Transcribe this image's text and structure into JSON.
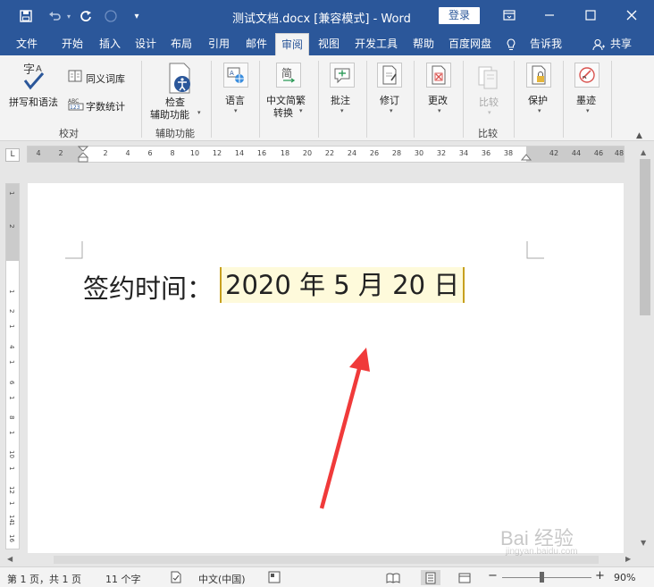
{
  "window": {
    "title": "测试文档.docx [兼容模式] - Word",
    "login_label": "登录",
    "quick_access": [
      "save-icon",
      "undo-icon",
      "redo-icon",
      "circle-icon",
      "customize-icon"
    ],
    "controls": [
      "ribbon-display-icon",
      "minimize-icon",
      "maximize-icon",
      "close-icon"
    ]
  },
  "tabs": [
    "文件",
    "开始",
    "插入",
    "设计",
    "布局",
    "引用",
    "邮件",
    "审阅",
    "视图",
    "开发工具",
    "帮助",
    "百度网盘"
  ],
  "active_tab": "审阅",
  "tell_me": "告诉我",
  "share": "共享",
  "ribbon": {
    "proofing": {
      "spelling": "拼写和语法",
      "thesaurus": "同义词库",
      "word_count": "字数统计",
      "group": "校对"
    },
    "accessibility": {
      "check_line1": "检查",
      "check_line2": "辅助功能",
      "group": "辅助功能"
    },
    "language": "语言",
    "chinese_conv_line1": "中文简繁",
    "chinese_conv_line2": "转换",
    "comments": "批注",
    "tracking": "修订",
    "changes": "更改",
    "compare": {
      "button": "比较",
      "group": "比较"
    },
    "protect": "保护",
    "ink": "墨迹"
  },
  "ruler": {
    "tab_selector": "L",
    "h_numbers": [
      "4",
      "2",
      "2",
      "4",
      "6",
      "8",
      "10",
      "12",
      "14",
      "16",
      "18",
      "20",
      "22",
      "24",
      "26",
      "28",
      "30",
      "32",
      "34",
      "36",
      "38",
      "42",
      "44",
      "46",
      "48"
    ],
    "v_numbers": [
      "1",
      "2",
      "1",
      "2",
      "1",
      "4",
      "1",
      "6",
      "1",
      "8",
      "1",
      "10",
      "1",
      "12",
      "1",
      "14",
      "1",
      "16"
    ]
  },
  "document": {
    "label": "签约时间：",
    "date_field": "2020 年 5 月 20 日"
  },
  "status": {
    "page": "第 1 页，共 1 页",
    "words": "11 个字",
    "language": "中文(中国)",
    "zoom": "90%",
    "zoom_fraction": 0.9
  },
  "watermark": {
    "text": "Bai 经验",
    "sub": "jingyan.baidu.com"
  },
  "colors": {
    "word_blue": "#2b579a",
    "field_bg": "#fefadb",
    "field_border": "#c7a01e",
    "arrow": "#f03a3a"
  }
}
